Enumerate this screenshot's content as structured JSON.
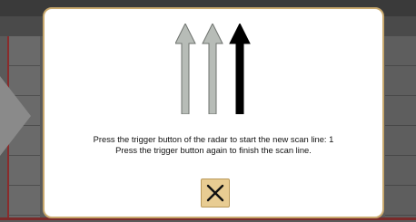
{
  "dialog": {
    "line1": "Press the trigger button of the radar to start the new scan line: 1",
    "line2": "Press the trigger button again to finish the scan line.",
    "close_icon": "close-icon",
    "arrow_icons": [
      "arrow-up-icon",
      "arrow-up-icon",
      "arrow-up-icon"
    ],
    "colors": {
      "border": "#c9a96e",
      "button": "#e8cc92",
      "arrow_inactive": "#b7bcb7",
      "arrow_active": "#000000"
    }
  },
  "background": {
    "nav_icon": "chevron-left-icon"
  }
}
